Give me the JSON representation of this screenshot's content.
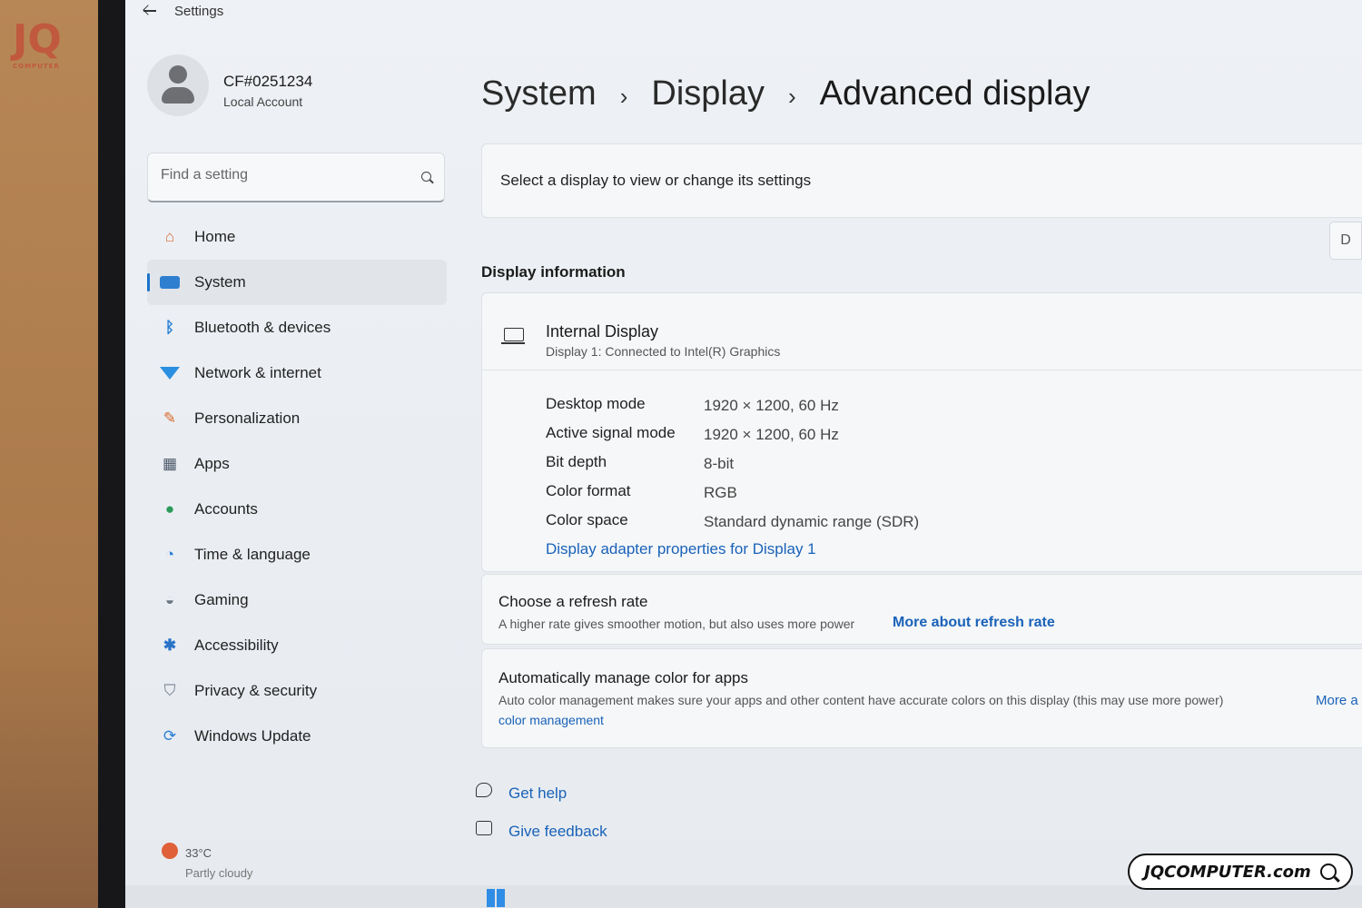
{
  "window": {
    "title": "Settings"
  },
  "account": {
    "name": "CF#0251234",
    "type": "Local Account"
  },
  "search": {
    "placeholder": "Find a setting"
  },
  "nav": {
    "items": [
      {
        "label": "Home",
        "icon": "home-icon"
      },
      {
        "label": "System",
        "icon": "system-icon",
        "active": true
      },
      {
        "label": "Bluetooth & devices",
        "icon": "bluetooth-icon"
      },
      {
        "label": "Network & internet",
        "icon": "wifi-icon"
      },
      {
        "label": "Personalization",
        "icon": "brush-icon"
      },
      {
        "label": "Apps",
        "icon": "apps-icon"
      },
      {
        "label": "Accounts",
        "icon": "person-icon"
      },
      {
        "label": "Time & language",
        "icon": "globe-clock-icon"
      },
      {
        "label": "Gaming",
        "icon": "gamepad-icon"
      },
      {
        "label": "Accessibility",
        "icon": "accessibility-icon"
      },
      {
        "label": "Privacy & security",
        "icon": "shield-icon"
      },
      {
        "label": "Windows Update",
        "icon": "update-icon"
      }
    ]
  },
  "weather": {
    "temp": "33°C",
    "condition": "Partly cloudy"
  },
  "breadcrumb": [
    "System",
    "Display",
    "Advanced display"
  ],
  "select_display": {
    "text": "Select a display to view or change its settings",
    "button_label": "D"
  },
  "display_info": {
    "section_title": "Display information",
    "name": "Internal Display",
    "subtitle": "Display 1: Connected to Intel(R) Graphics",
    "specs": [
      {
        "label": "Desktop mode",
        "value": "1920 × 1200, 60 Hz"
      },
      {
        "label": "Active signal mode",
        "value": "1920 × 1200, 60 Hz"
      },
      {
        "label": "Bit depth",
        "value": "8-bit"
      },
      {
        "label": "Color format",
        "value": "RGB"
      },
      {
        "label": "Color space",
        "value": "Standard dynamic range (SDR)"
      }
    ],
    "adapter_link": "Display adapter properties for Display 1"
  },
  "refresh": {
    "title": "Choose a refresh rate",
    "description": "A higher rate gives smoother motion, but also uses more power",
    "link": "More about refresh rate"
  },
  "color_mgmt": {
    "title": "Automatically manage color for apps",
    "description": "Auto color management makes sure your apps and other content have accurate colors on this display (this may use more power)",
    "more_link": "More a",
    "link_line2": "color management"
  },
  "footer": {
    "get_help": "Get help",
    "give_feedback": "Give feedback"
  },
  "watermark": {
    "text": "JQCOMPUTER.com"
  },
  "colors": {
    "accent": "#1a73c8",
    "link": "#1a62b8"
  }
}
